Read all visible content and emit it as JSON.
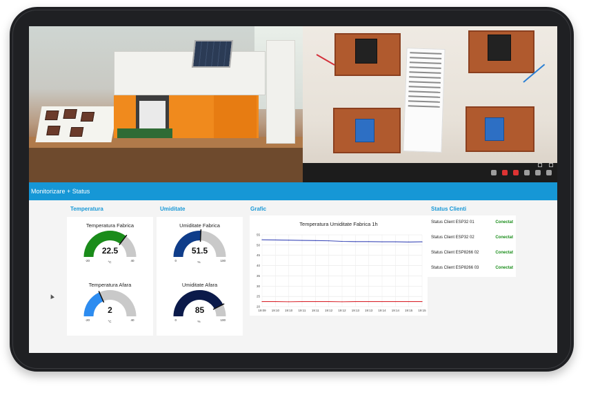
{
  "colors": {
    "header_bg": "#1697d6",
    "accent": "#1697d6",
    "status_ok": "#1a8d1a",
    "gauge_track": "#c9c9c9",
    "gauge_temp_fabrica": "#1a8c1a",
    "gauge_temp_afara": "#2d8cf0",
    "gauge_umid_fabrica": "#0f3d8a",
    "gauge_umid_afara": "#0b1a4a",
    "series_temp": "#d9272e",
    "series_umid": "#3b49b8"
  },
  "header": {
    "title": "Monitorizare + Status"
  },
  "groups": {
    "temperatura": "Temperatura",
    "umiditate": "Umiditate",
    "grafic": "Grafic",
    "status": "Status Clienti"
  },
  "gauges": [
    {
      "title": "Temperatura Fabrica",
      "value": 22.5,
      "display": "22.5",
      "min": "-20",
      "max": "40",
      "min_num": -20,
      "max_num": 40,
      "unit": "°C",
      "color_key": "gauge_temp_fabrica"
    },
    {
      "title": "Umiditate Fabrica",
      "value": 51.5,
      "display": "51.5",
      "min": "0",
      "max": "100",
      "min_num": 0,
      "max_num": 100,
      "unit": "%",
      "color_key": "gauge_umid_fabrica"
    },
    {
      "title": "Temperatura Afara",
      "value": 2,
      "display": "2",
      "min": "-20",
      "max": "40",
      "min_num": -20,
      "max_num": 40,
      "unit": "°C",
      "color_key": "gauge_temp_afara"
    },
    {
      "title": "Umiditate Afara",
      "value": 85,
      "display": "85",
      "min": "0",
      "max": "100",
      "min_num": 0,
      "max_num": 100,
      "unit": "%",
      "color_key": "gauge_umid_afara"
    }
  ],
  "status_clients": [
    {
      "label": "Status Client ESP32 01",
      "value": "Conectat"
    },
    {
      "label": "Status Client ESP32 02",
      "value": "Conectat"
    },
    {
      "label": "Status Client ESP8266 02",
      "value": "Conectat"
    },
    {
      "label": "Status Client ESP8266 03",
      "value": "Conectat"
    }
  ],
  "chart_data": {
    "type": "line",
    "title": "Temperatura Umiditate Fabrica 1h",
    "xlabel": "",
    "ylabel": "",
    "categories": [
      "19:09",
      "19:10",
      "19:10",
      "19:11",
      "19:11",
      "19:12",
      "19:12",
      "19:13",
      "19:13",
      "19:14",
      "19:14",
      "19:15",
      "19:15"
    ],
    "ylim": [
      20,
      55
    ],
    "yticks": [
      "20",
      "25",
      "30",
      "35",
      "40",
      "45",
      "50",
      "55"
    ],
    "grid": true,
    "series": [
      {
        "values": [
          52.6,
          52.5,
          52.4,
          52.3,
          52.2,
          52.1,
          51.8,
          51.7,
          51.7,
          51.6,
          51.6,
          51.5,
          51.6
        ],
        "color_key": "series_umid"
      },
      {
        "values": [
          22.5,
          22.5,
          22.4,
          22.5,
          22.5,
          22.5,
          22.4,
          22.5,
          22.5,
          22.5,
          22.5,
          22.5,
          22.5
        ],
        "color_key": "series_temp"
      }
    ]
  }
}
